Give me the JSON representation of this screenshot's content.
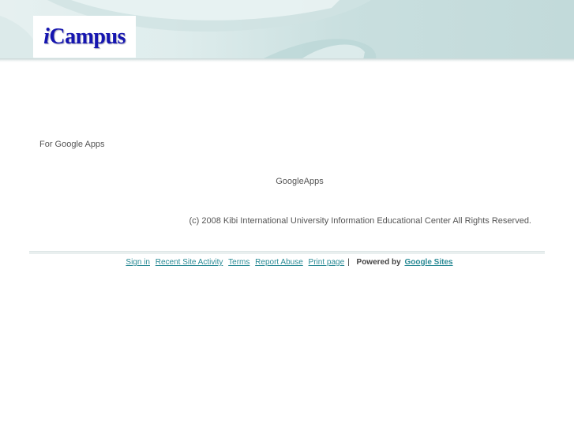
{
  "header": {
    "logo_prefix": "i",
    "logo_suffix": "Campus"
  },
  "content": {
    "tagline": "For Google Apps",
    "center_text": "GoogleApps",
    "copyright": "(c) 2008 Kibi International University Information Educational Center All Rights Reserved."
  },
  "footer": {
    "links": [
      {
        "label": "Sign in"
      },
      {
        "label": "Recent Site Activity"
      },
      {
        "label": "Terms"
      },
      {
        "label": "Report Abuse"
      },
      {
        "label": "Print page"
      }
    ],
    "separator": "|",
    "powered_by": "Powered by",
    "powered_link": "Google Sites"
  },
  "colors": {
    "logo": "#1515b0",
    "link": "#2a8a95",
    "header_teal": "#c2dada"
  }
}
